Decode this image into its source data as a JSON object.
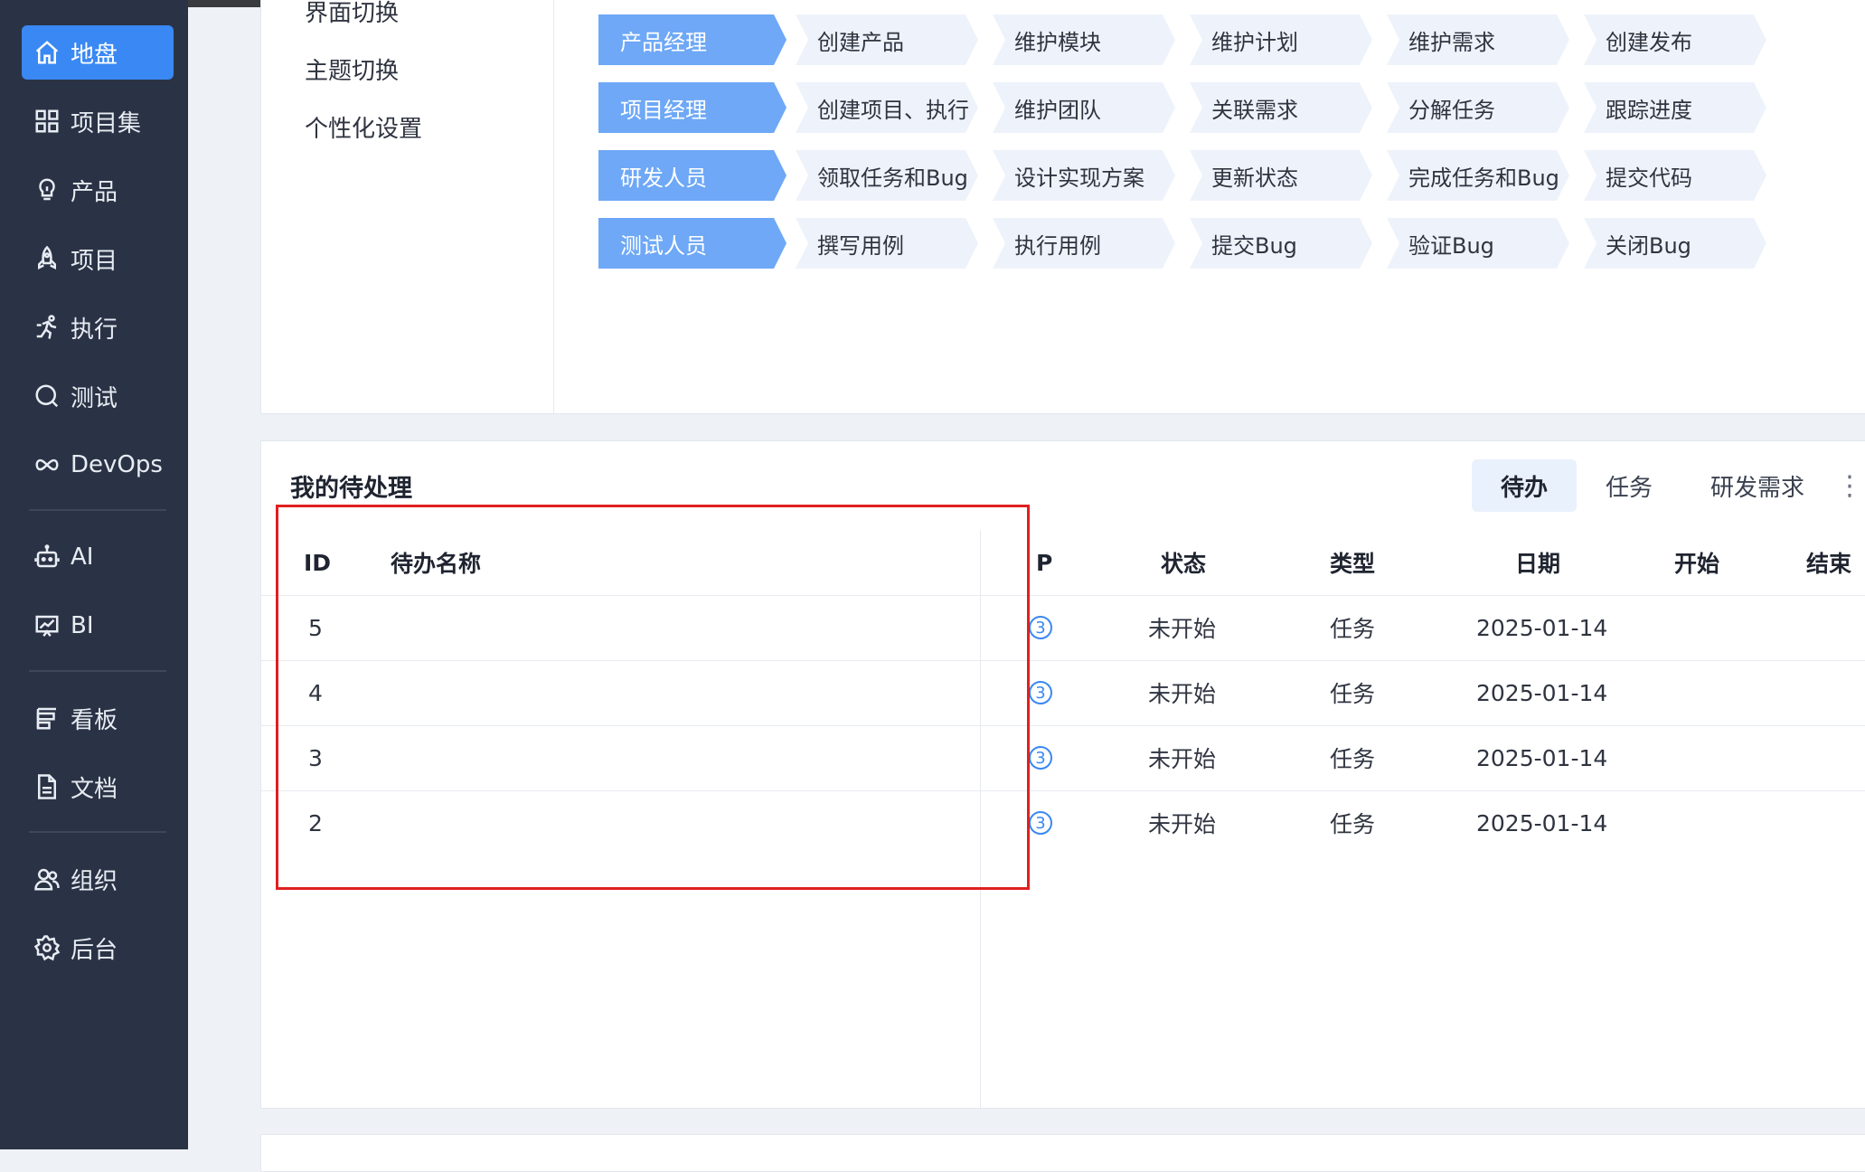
{
  "sidebar": {
    "items": [
      {
        "label": "地盘",
        "icon": "home-icon",
        "active": true
      },
      {
        "label": "项目集",
        "icon": "grid-icon"
      },
      {
        "label": "产品",
        "icon": "bulb-icon"
      },
      {
        "label": "项目",
        "icon": "rocket-icon"
      },
      {
        "label": "执行",
        "icon": "run-icon"
      },
      {
        "label": "测试",
        "icon": "search-icon"
      },
      {
        "label": "DevOps",
        "icon": "infinity-icon"
      },
      {
        "label": "AI",
        "icon": "robot-icon"
      },
      {
        "label": "BI",
        "icon": "chart-board-icon"
      },
      {
        "label": "看板",
        "icon": "kanban-icon"
      },
      {
        "label": "文档",
        "icon": "document-icon"
      },
      {
        "label": "组织",
        "icon": "users-icon"
      },
      {
        "label": "后台",
        "icon": "gear-icon"
      }
    ]
  },
  "settings_menu": {
    "items": [
      "界面切换",
      "主题切换",
      "个性化设置"
    ]
  },
  "workflow": {
    "rows": [
      {
        "role": "产品经理",
        "steps": [
          "创建产品",
          "维护模块",
          "维护计划",
          "维护需求",
          "创建发布"
        ]
      },
      {
        "role": "项目经理",
        "steps": [
          "创建项目、执行",
          "维护团队",
          "关联需求",
          "分解任务",
          "跟踪进度"
        ]
      },
      {
        "role": "研发人员",
        "steps": [
          "领取任务和Bug",
          "设计实现方案",
          "更新状态",
          "完成任务和Bug",
          "提交代码"
        ]
      },
      {
        "role": "测试人员",
        "steps": [
          "撰写用例",
          "执行用例",
          "提交Bug",
          "验证Bug",
          "关闭Bug"
        ]
      }
    ]
  },
  "todo": {
    "title": "我的待处理",
    "tabs": [
      "待办",
      "任务",
      "研发需求"
    ],
    "more": "⋮",
    "columns": {
      "id": "ID",
      "name": "待办名称",
      "pri": "P",
      "status": "状态",
      "type": "类型",
      "date": "日期",
      "begin": "开始",
      "end": "结束"
    },
    "rows": [
      {
        "id": "5",
        "name": "",
        "pri": "3",
        "status": "未开始",
        "type": "任务",
        "date": "2025-01-14"
      },
      {
        "id": "4",
        "name": "",
        "pri": "3",
        "status": "未开始",
        "type": "任务",
        "date": "2025-01-14"
      },
      {
        "id": "3",
        "name": "",
        "pri": "3",
        "status": "未开始",
        "type": "任务",
        "date": "2025-01-14"
      },
      {
        "id": "2",
        "name": "",
        "pri": "3",
        "status": "未开始",
        "type": "任务",
        "date": "2025-01-14"
      }
    ]
  },
  "colors": {
    "sidebar_bg": "#2a3345",
    "accent": "#3a88f3",
    "role_chip": "#6ea8f6",
    "step_chip": "#eef3fb",
    "highlight": "#e02020"
  }
}
